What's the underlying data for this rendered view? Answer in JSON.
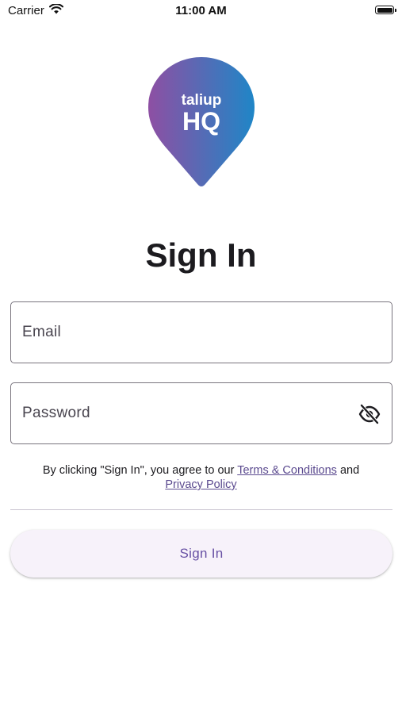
{
  "status_bar": {
    "carrier": "Carrier",
    "time": "11:00 AM",
    "icons": [
      "wifi-icon",
      "battery-icon"
    ]
  },
  "logo": {
    "brand_top": "taliup",
    "brand_bottom": "HQ",
    "gradient_colors": [
      "#8e4fa3",
      "#1f86c7"
    ],
    "icon": "map-pin-logo"
  },
  "title": "Sign In",
  "email": {
    "placeholder": "Email",
    "value": ""
  },
  "password": {
    "placeholder": "Password",
    "value": "",
    "toggle_icon": "eye-off-icon"
  },
  "terms": {
    "prefix": "By clicking \"Sign In\", you agree to our ",
    "terms_link": "Terms & Conditions",
    "middle": " and",
    "privacy_link": "Privacy Policy"
  },
  "signin_button": {
    "label": "Sign In"
  },
  "colors": {
    "primary": "#6750a4",
    "link": "#5b4a8f",
    "outline": "#79747e",
    "button_bg": "#f7f2fa"
  }
}
